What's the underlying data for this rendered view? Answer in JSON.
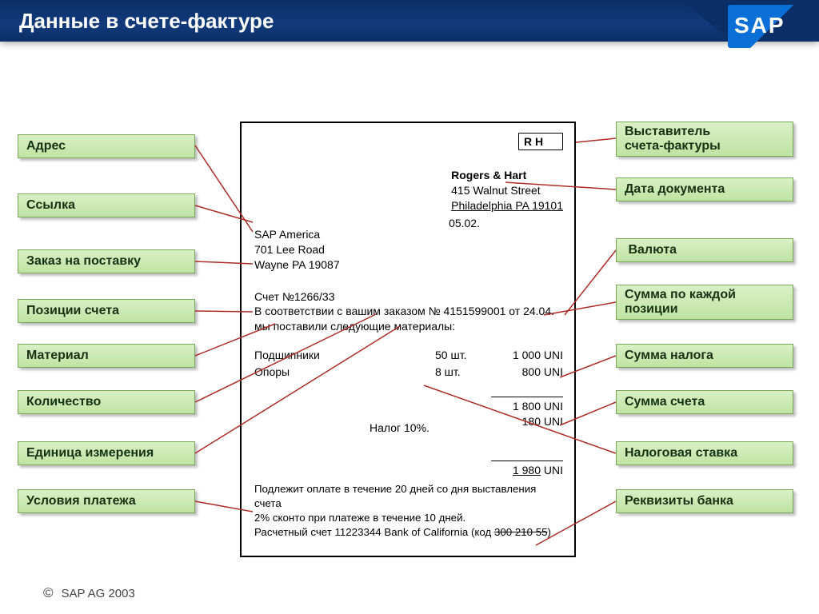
{
  "title": "Данные в счете-фактуре",
  "logo_text": "SAP",
  "footer_copy": "©",
  "footer_text": "SAP AG 2003",
  "left_tags": {
    "address": "Адрес",
    "reference": "Ссылка",
    "purchase_order": "Заказ на поставку",
    "invoice_items": "Позиции счета",
    "material": "Материал",
    "quantity": "Количество",
    "uom": "Единица измерения",
    "payment_terms": "Условия платежа"
  },
  "right_tags": {
    "issuer_l1": "Выставитель",
    "issuer_l2": "счета-фактуры",
    "doc_date": "Дата документа",
    "currency": "Валюта",
    "line_amount_l1": "Сумма по каждой",
    "line_amount_l2": "позиции",
    "tax_amount": "Сумма налога",
    "invoice_amount": "Сумма счета",
    "tax_rate": "Налоговая ставка",
    "bank_details": "Реквизиты банка"
  },
  "invoice": {
    "rh": "R H",
    "issuer_name": "Rogers & Hart",
    "issuer_addr1": "415 Walnut Street",
    "issuer_addr2": "Philadelphia PA 19101",
    "doc_date": "05.02.",
    "soldto_name": "SAP America",
    "soldto_addr1": "701 Lee Road",
    "soldto_addr2": "Wayne PA 19087",
    "invno": "Счет №1266/33",
    "po_text_l1": "В соответствии с вашим заказом № 4151599001 от 24.04.",
    "po_text_l2": "мы поставили следующие материалы:",
    "item1_name": "Подшипники",
    "item1_qty": "50 шт.",
    "item1_amt": "1 000 UNI",
    "item2_name": "Опоры",
    "item2_qty": "8 шт.",
    "item2_amt": "800 UNI",
    "subtotal": "1 800 UNI",
    "tax_line": "180 UNI",
    "tax_rate_text": "Налог 10%.",
    "total_amt": "1 980",
    "total_cur": " UNI",
    "pay_l1": "Подлежит оплате в течение 20 дней со дня выставления",
    "pay_l2": "счета",
    "pay_l3": "2% сконто при платеже в течение 10 дней.",
    "pay_l4a": "Расчетный счет 11223344 Bank of California (код ",
    "pay_l4b": "300 210 55",
    "pay_l4c": ")"
  }
}
